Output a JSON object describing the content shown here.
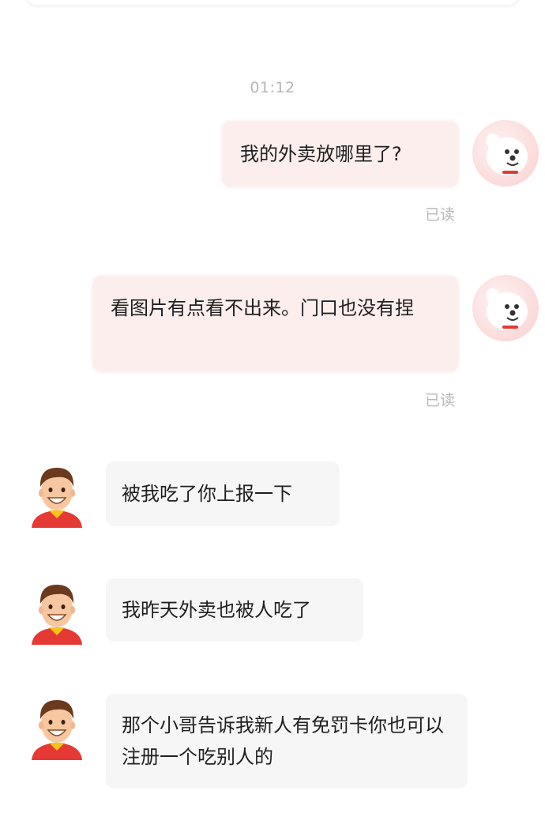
{
  "chat": {
    "timestamp": "01:12",
    "messages": [
      {
        "from": "me",
        "text": "我的外卖放哪里了?",
        "status": "已读"
      },
      {
        "from": "me",
        "text": "看图片有点看不出来。门口也没有捏",
        "status": "已读"
      },
      {
        "from": "courier",
        "text": "被我吃了你上报一下"
      },
      {
        "from": "courier",
        "text": "我昨天外卖也被人吃了"
      },
      {
        "from": "courier",
        "text": "那个小哥告诉我新人有免罚卡你也可以注册一个吃别人的"
      }
    ]
  },
  "avatars": {
    "me_icon": "jd-dog-mascot-icon",
    "courier_icon": "courier-cartoon-icon"
  },
  "colors": {
    "outgoing_bubble": "#fdeeee",
    "incoming_bubble": "#f6f6f6",
    "read_status": "#b9b9b9",
    "timestamp": "#b6b6b6"
  }
}
